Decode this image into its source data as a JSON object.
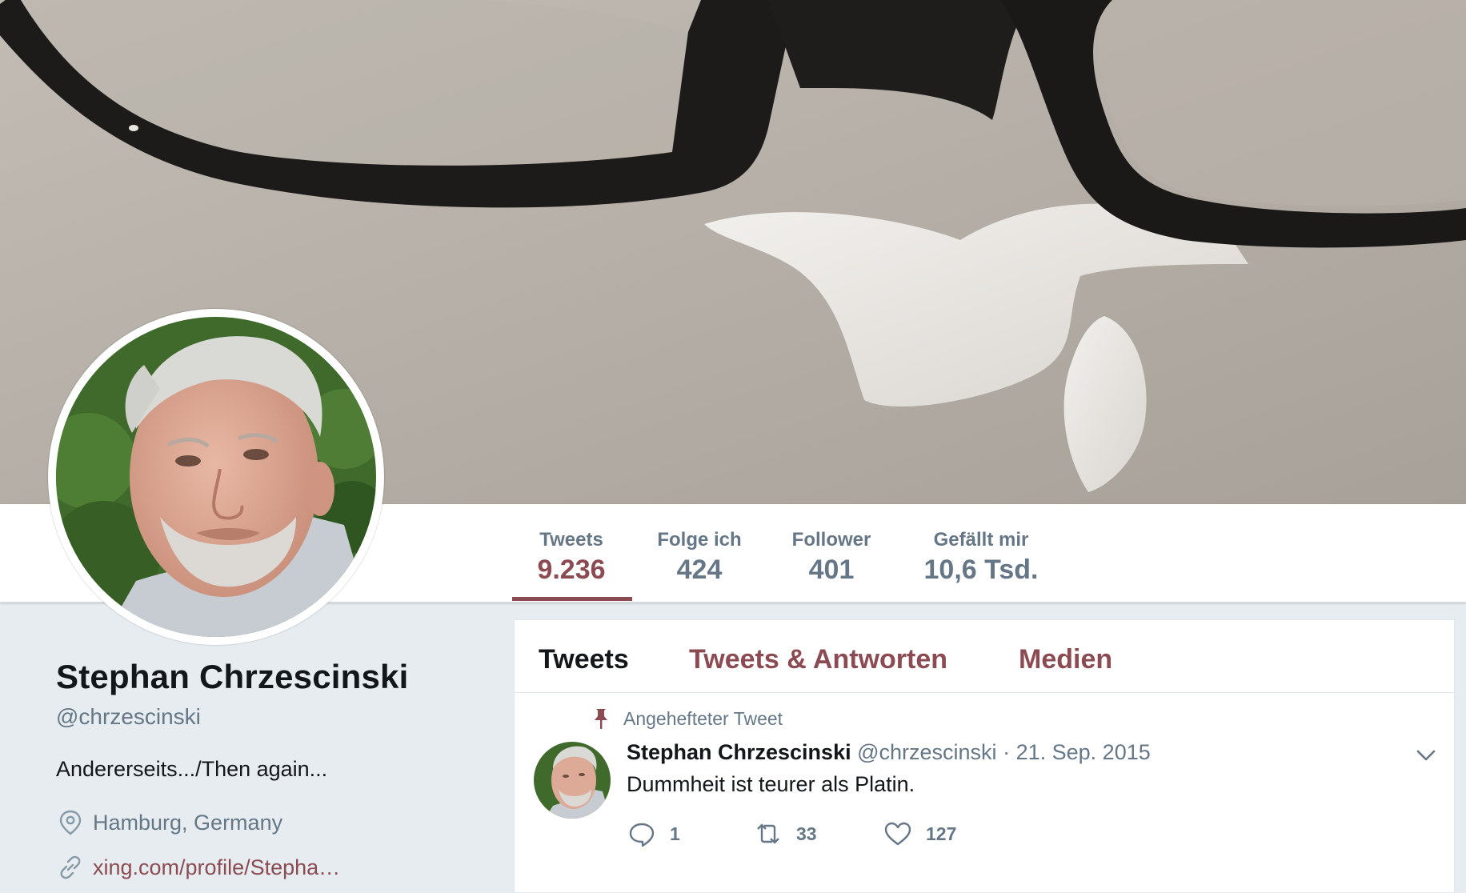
{
  "colors": {
    "accent": "#8c4b52",
    "muted": "#657786",
    "text": "#14171a",
    "background": "#e6ecf0"
  },
  "nav": {
    "stats": [
      {
        "label": "Tweets",
        "value": "9.236",
        "active": true
      },
      {
        "label": "Folge ich",
        "value": "424",
        "active": false
      },
      {
        "label": "Follower",
        "value": "401",
        "active": false
      },
      {
        "label": "Gefällt mir",
        "value": "10,6 Tsd.",
        "active": false
      }
    ]
  },
  "profile": {
    "name": "Stephan Chrzescinski",
    "handle": "@chrzescinski",
    "bio": "Andererseits.../Then again...",
    "location": "Hamburg, Germany",
    "link": "xing.com/profile/Stepha…",
    "location_icon": "location-pin-icon",
    "link_icon": "link-icon"
  },
  "timeline": {
    "tabs": [
      {
        "label": "Tweets",
        "active": true
      },
      {
        "label": "Tweets & Antworten",
        "active": false
      },
      {
        "label": "Medien",
        "active": false
      }
    ],
    "pinned_label": "Angehefteter Tweet",
    "tweet": {
      "name": "Stephan Chrzescinski",
      "handle": "@chrzescinski",
      "separator": "·",
      "date": "21. Sep. 2015",
      "text": "Dummheit ist teurer als Platin.",
      "replies": "1",
      "retweets": "33",
      "likes": "127"
    }
  }
}
